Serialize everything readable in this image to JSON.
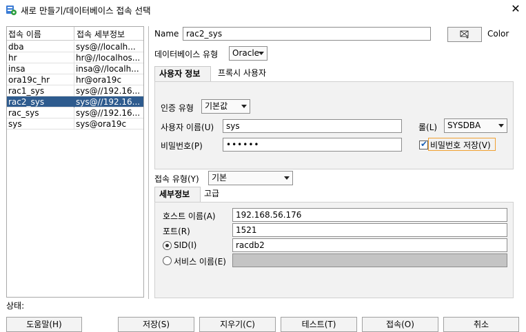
{
  "window": {
    "title": "새로 만들기/데이터베이스 접속 선택",
    "close_glyph": "✕"
  },
  "connections": {
    "headers": [
      "접속 이름",
      "접속 세부정보"
    ],
    "rows": [
      {
        "name": "dba",
        "detail": "sys@//localh..."
      },
      {
        "name": "hr",
        "detail": "hr@//localhos..."
      },
      {
        "name": "insa",
        "detail": "insa@//localh..."
      },
      {
        "name": "ora19c_hr",
        "detail": "hr@ora19c"
      },
      {
        "name": "rac1_sys",
        "detail": "sys@//192.16..."
      },
      {
        "name": "rac2_sys",
        "detail": "sys@//192.16..."
      },
      {
        "name": "rac_sys",
        "detail": "sys@//192.16..."
      },
      {
        "name": "sys",
        "detail": "sys@ora19c"
      }
    ],
    "selected_index": 5
  },
  "form": {
    "name_label": "Name",
    "name_value": "rac2_sys",
    "color_label": "Color",
    "db_type_label": "데이터베이스 유형",
    "db_type_value": "Oracle",
    "tabs": [
      "사용자 정보",
      "프록시 사용자"
    ],
    "auth_type_label": "인증 유형",
    "auth_type_value": "기본값",
    "username_label": "사용자 이름(U)",
    "username_value": "sys",
    "role_label": "롤(L)",
    "role_value": "SYSDBA",
    "password_label": "비밀번호(P)",
    "password_value": "••••••",
    "save_password_label": "비밀번호 저장(V)",
    "save_password_checked": true,
    "conn_type_label": "접속 유형(Y)",
    "conn_type_value": "기본",
    "conn_tabs": [
      "세부정보",
      "고급"
    ],
    "host_label": "호스트 이름(A)",
    "host_value": "192.168.56.176",
    "port_label": "포트(R)",
    "port_value": "1521",
    "sid_label": "SID(I)",
    "sid_value": "racdb2",
    "service_label": "서비스 이름(E)",
    "service_value": ""
  },
  "status": {
    "label": "상태:"
  },
  "buttons": {
    "help": "도움말(H)",
    "save": "저장(S)",
    "clear": "지우기(C)",
    "test": "테스트(T)",
    "connect": "접속(O)",
    "cancel": "취소"
  },
  "colors": {
    "selection": "#2e5b8e",
    "panel_bg": "#f2f2f2",
    "focus_border": "#f0a030"
  }
}
